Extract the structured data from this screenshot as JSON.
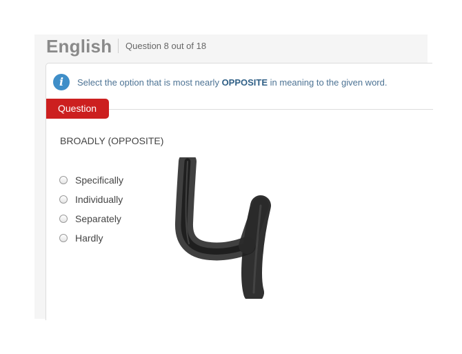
{
  "header": {
    "subject": "English",
    "progress": "Question 8 out of 18"
  },
  "instruction": {
    "before": "Select the option that is most nearly ",
    "emphasis": "OPPOSITE",
    "after": " in meaning to the given word.",
    "icon": "info-icon"
  },
  "tab": {
    "label": "Question"
  },
  "question": {
    "word": "BROADLY (OPPOSITE)",
    "options": [
      "Specifically",
      "Individually",
      "Separately",
      "Hardly"
    ],
    "selected": null
  },
  "colors": {
    "tab_red": "#cc1f1f",
    "info_blue": "#3f8ec8",
    "instruction_text": "#4d7394"
  }
}
